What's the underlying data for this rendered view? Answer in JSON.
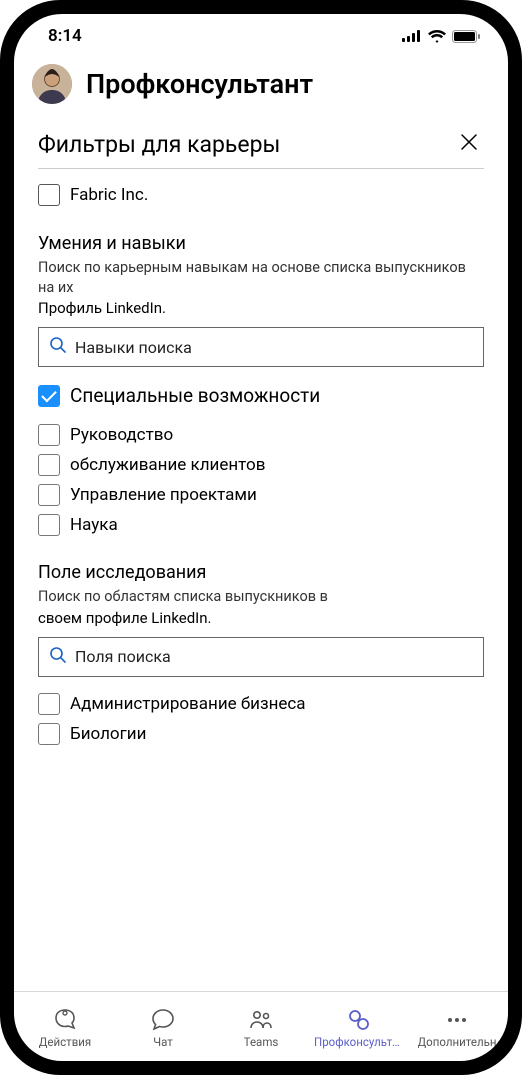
{
  "status": {
    "time": "8:14"
  },
  "header": {
    "title": "Профконсультант"
  },
  "panel": {
    "title": "Фильтры для карьеры",
    "company_item": "Fabric Inc."
  },
  "skills": {
    "title": "Умения и навыки",
    "desc_line1": "Поиск по карьерным навыкам на основе списка выпускников на их",
    "desc_line2": "Профиль LinkedIn.",
    "search_placeholder": "Навыки поиска",
    "special_label": "Специальные возможности",
    "items": [
      {
        "label": "Руководство"
      },
      {
        "label": "обслуживание клиентов"
      },
      {
        "label": "Управление проектами"
      },
      {
        "label": "Наука"
      }
    ]
  },
  "research": {
    "title": "Поле исследования",
    "desc_line1": "Поиск по областям списка выпускников в",
    "desc_line2": "своем профиле LinkedIn.",
    "search_placeholder": "Поля поиска",
    "items": [
      {
        "label": "Администрирование бизнеса"
      },
      {
        "label": "Биологии"
      }
    ]
  },
  "tabs": {
    "activity": "Действия",
    "chat": "Чат",
    "teams": "Teams",
    "coach": "Профконсультант",
    "more": "Дополнительн"
  }
}
